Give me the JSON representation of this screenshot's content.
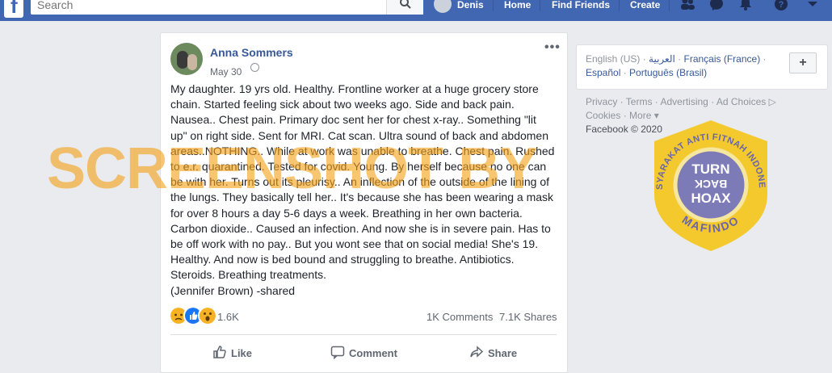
{
  "topbar": {
    "logo": "f",
    "search_placeholder": "Search",
    "user": "Denis",
    "home": "Home",
    "find_friends": "Find Friends",
    "create": "Create"
  },
  "post": {
    "author": "Anna Sommers",
    "date": "May 30",
    "more": "•••",
    "text": [
      "My daughter. 19 yrs old. Healthy. Frontline worker at a huge grocery store",
      "chain. Started feeling sick about two weeks ago. Side and back pain.",
      "Nausea.. Chest pain. Primary doc sent her for chest x-ray.. Something \"lit",
      "up\" on right side. Sent for MRI. Cat scan. Ultra sound of back and abdomen",
      "areas..NOTHING.. While at work was unable to breathe. Chest pain. Rushed",
      "to e.r. quarantined. Tested for covid. Young. By herself because no one can",
      "be with her. Turns out its pleurisy.. An inflection of the outside of the lining of",
      "the lungs. They basically tell her.. It's because she has been wearing a mask",
      "for over 8 hours a day 5-6 days a week. Breathing in her own bacteria.",
      "Carbon dioxide.. Caused an infection. And now she is in severe pain. Has to",
      "be off work with no pay.. But you wont see that on social media! She's 19.",
      "Healthy. And now is bed bound and struggling to breathe. Antibiotics.",
      "Steroids. Breathing treatments.",
      "(Jennifer Brown) -shared"
    ],
    "reaction_count": "1.6K",
    "comments": "1K Comments",
    "shares": "7.1K Shares",
    "actions": {
      "like": "Like",
      "comment": "Comment",
      "share": "Share"
    }
  },
  "languages": {
    "current": "English (US)",
    "others": [
      "العربية",
      "Français (France)",
      "Español",
      "Português (Brasil)"
    ],
    "separator": " · ",
    "plus": "+"
  },
  "footer": {
    "links": [
      "Privacy",
      "Terms",
      "Advertising",
      "Ad Choices ▷",
      "Cookies",
      "More ▾"
    ],
    "copyright": "Facebook © 2020"
  },
  "watermark": "SCREENSHOT BY",
  "stamp": {
    "ring_text": "MASYARAKAT ANTI FITNAH INDONESIA",
    "bottom_text": "MAFINDO",
    "center": [
      "TURN",
      "BACK",
      "HOAX"
    ]
  },
  "colors": {
    "brand": "#4267b2",
    "link": "#385898",
    "watermark": "#f4a21a",
    "stamp_gold": "#f5c518",
    "stamp_purple": "#7d7ab8"
  }
}
